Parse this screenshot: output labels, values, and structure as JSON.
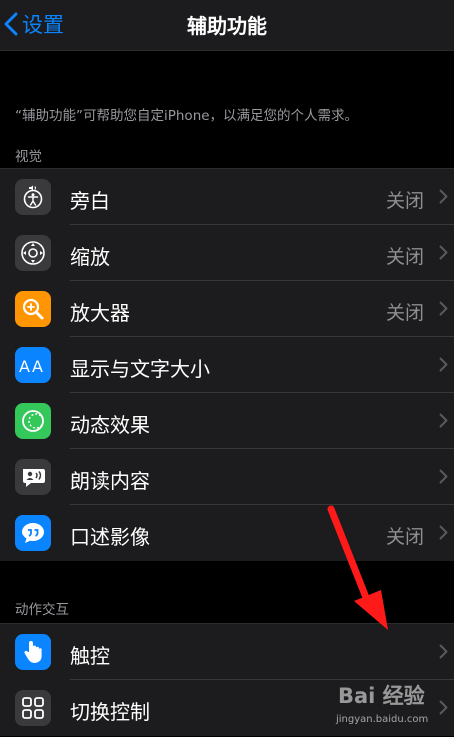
{
  "nav": {
    "back_label": "设置",
    "title": "辅助功能"
  },
  "description": "“辅助功能”可帮助您自定iPhone，以满足您的个人需求。",
  "sections": [
    {
      "header": "视觉",
      "items": [
        {
          "label": "旁白",
          "value": "关闭",
          "icon": "voiceover-icon",
          "color": "#3a3a3c"
        },
        {
          "label": "缩放",
          "value": "关闭",
          "icon": "zoom-icon",
          "color": "#3a3a3c"
        },
        {
          "label": "放大器",
          "value": "关闭",
          "icon": "magnifier-icon",
          "color": "#ff9500"
        },
        {
          "label": "显示与文字大小",
          "value": "",
          "icon": "text-size-icon",
          "color": "#0a84ff"
        },
        {
          "label": "动态效果",
          "value": "",
          "icon": "motion-icon",
          "color": "#34c759"
        },
        {
          "label": "朗读内容",
          "value": "",
          "icon": "spoken-content-icon",
          "color": "#3a3a3c"
        },
        {
          "label": "口述影像",
          "value": "关闭",
          "icon": "audio-description-icon",
          "color": "#0a84ff"
        }
      ]
    },
    {
      "header": "动作交互",
      "items": [
        {
          "label": "触控",
          "value": "",
          "icon": "touch-icon",
          "color": "#0a84ff"
        },
        {
          "label": "切换控制",
          "value": "",
          "icon": "switch-control-icon",
          "color": "#3a3a3c"
        }
      ]
    }
  ],
  "watermark": {
    "main": "Bai 经验",
    "sub": "jingyan.baidu.com"
  },
  "colors": {
    "accent": "#0a84ff",
    "annotation_arrow": "#ff1a1a"
  }
}
